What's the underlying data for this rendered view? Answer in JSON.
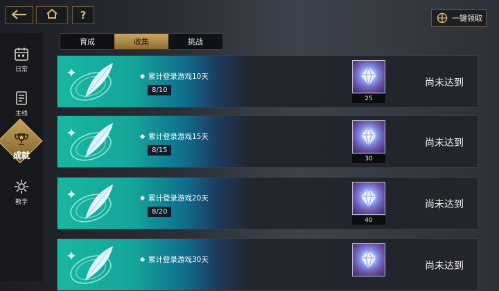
{
  "topbar": {
    "back_icon": "back-arrow-icon",
    "home_icon": "home-icon",
    "help_label": "?",
    "claim_all_label": "一键领取"
  },
  "sidebar": {
    "items": [
      {
        "label": "日常",
        "icon": "calendar-icon"
      },
      {
        "label": "主线",
        "icon": "checklist-icon"
      },
      {
        "label": "成就",
        "icon": "trophy-icon",
        "active": true
      },
      {
        "label": "教学",
        "icon": "gear-icon"
      }
    ]
  },
  "tabs": [
    {
      "label": "育成"
    },
    {
      "label": "收集",
      "active": true
    },
    {
      "label": "挑战"
    }
  ],
  "achievements": [
    {
      "title": "累计登录游戏10天",
      "progress": "8/10",
      "reward_count": "25",
      "status": "尚未达到"
    },
    {
      "title": "累计登录游戏15天",
      "progress": "8/15",
      "reward_count": "30",
      "status": "尚未达到"
    },
    {
      "title": "累计登录游戏20天",
      "progress": "8/20",
      "reward_count": "40",
      "status": "尚未达到"
    },
    {
      "title": "累计登录游戏30天",
      "progress": "",
      "reward_count": "",
      "status": "尚未达到"
    }
  ],
  "colors": {
    "accent_gold": "#c8a35a",
    "card_teal": "#19b7a2"
  }
}
